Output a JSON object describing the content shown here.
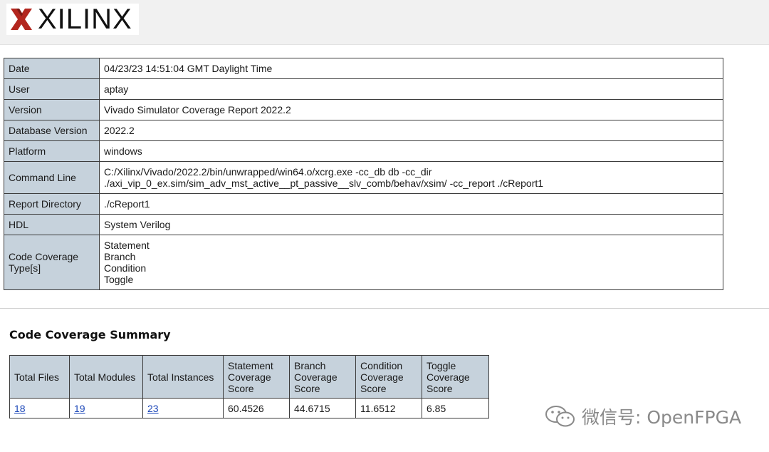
{
  "header": {
    "logo_text": "XILINX"
  },
  "report_info": [
    {
      "label": "Date",
      "value": "04/23/23 14:51:04 GMT Daylight Time"
    },
    {
      "label": "User",
      "value": "aptay"
    },
    {
      "label": "Version",
      "value": "Vivado Simulator Coverage Report 2022.2"
    },
    {
      "label": "Database Version",
      "value": "2022.2"
    },
    {
      "label": "Platform",
      "value": "windows"
    },
    {
      "label": "Command Line",
      "lines": [
        "C:/Xilinx/Vivado/2022.2/bin/unwrapped/win64.o/xcrg.exe -cc_db db -cc_dir",
        "./axi_vip_0_ex.sim/sim_adv_mst_active__pt_passive__slv_comb/behav/xsim/ -cc_report ./cReport1"
      ]
    },
    {
      "label": "Report Directory",
      "value": "./cReport1"
    },
    {
      "label": "HDL",
      "value": "System Verilog"
    },
    {
      "label_lines": [
        "Code Coverage",
        "Type[s]"
      ],
      "lines": [
        "Statement",
        "Branch",
        "Condition",
        "Toggle"
      ]
    }
  ],
  "summary": {
    "title": "Code Coverage Summary",
    "headers": [
      [
        "Total Files"
      ],
      [
        "Total Modules"
      ],
      [
        "Total Instances"
      ],
      [
        "Statement",
        "Coverage",
        "Score"
      ],
      [
        "Branch",
        "Coverage",
        "Score"
      ],
      [
        "Condition",
        "Coverage",
        "Score"
      ],
      [
        "Toggle",
        "Coverage",
        "Score"
      ]
    ],
    "values": [
      "18",
      "19",
      "23",
      "60.4526",
      "44.6715",
      "11.6512",
      "6.85"
    ]
  },
  "watermark": {
    "text": "微信号: OpenFPGA"
  },
  "colors": {
    "key_cell_bg": "#c6d2dc",
    "link": "#1a46b8",
    "logo_red": "#b3261e"
  }
}
